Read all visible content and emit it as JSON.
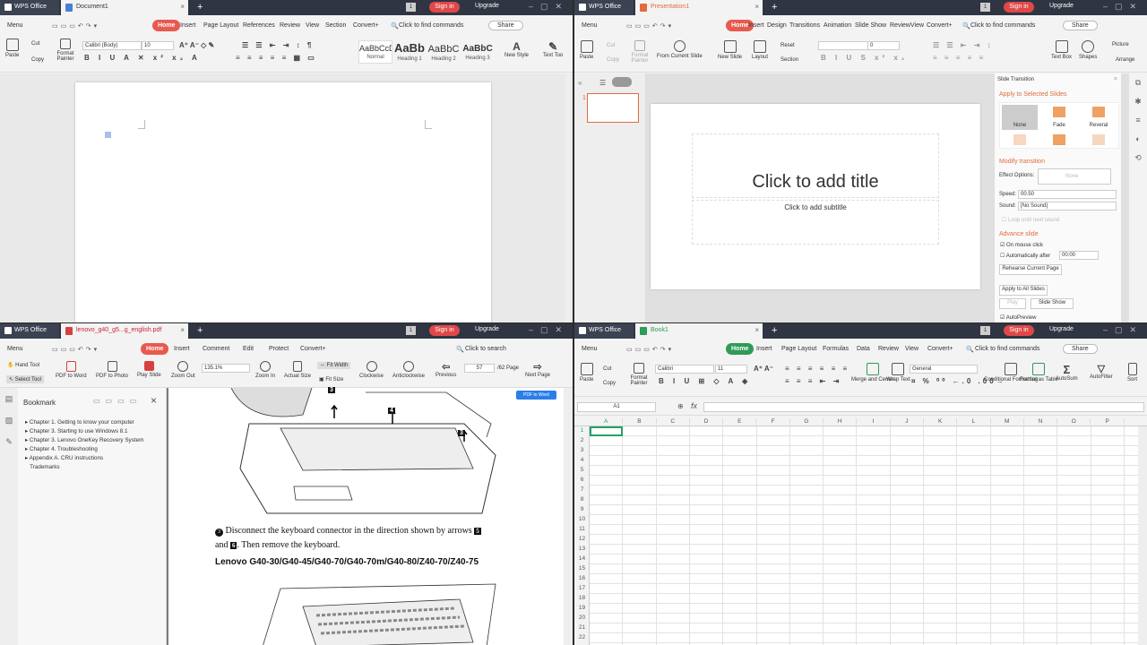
{
  "writer": {
    "app_tab": "WPS Office",
    "doc_tab": "Document1",
    "menu": [
      "Menu",
      "Home",
      "Insert",
      "Page Layout",
      "References",
      "Review",
      "View",
      "Section",
      "Convert+"
    ],
    "find": "Click to find commands",
    "share": "Share",
    "sign_in": "Sign in",
    "upgrade": "Upgrade",
    "paste": "Paste",
    "cut": "Cut",
    "copy": "Copy",
    "format_painter": "Format Painter",
    "font": "Calibri (Body)",
    "size": "10",
    "styles": [
      {
        "sample": "AaBbCcDd",
        "label": "Normal"
      },
      {
        "sample": "AaBb",
        "label": "Heading 1"
      },
      {
        "sample": "AaBbC",
        "label": "Heading 2"
      },
      {
        "sample": "AaBbC",
        "label": "Heading 3"
      }
    ],
    "new_style": "New Style",
    "text_tool": "Text Too"
  },
  "presentation": {
    "app_tab": "WPS Office",
    "doc_tab": "Presentation1",
    "menu": [
      "Menu",
      "Home",
      "Insert",
      "Design",
      "Transitions",
      "Animation",
      "Slide Show",
      "Review",
      "View",
      "Convert+"
    ],
    "find": "Click to find commands",
    "share": "Share",
    "sign_in": "Sign in",
    "upgrade": "Upgrade",
    "paste": "Paste",
    "cut": "Cut",
    "copy": "Copy",
    "format_painter": "Format Painter",
    "from_current": "From Current Slide",
    "new_slide": "New Slide",
    "layout": "Layout",
    "reset": "Reset",
    "section": "Section",
    "font_size": "0",
    "text_box": "Text Box",
    "shapes": "Shapes",
    "picture": "Picture",
    "arrange": "Arrange",
    "slide_num": "1",
    "title_placeholder": "Click to add title",
    "subtitle_placeholder": "Click to add subtitle",
    "pane": {
      "title": "Slide Transition",
      "apply_selected": "Apply to Selected Slides",
      "transitions": [
        "None",
        "Fade",
        "Reveral"
      ],
      "modify": "Modify transition",
      "effect_label": "Effect Options:",
      "effect_value": "None",
      "speed_label": "Speed:",
      "speed_value": "00.50",
      "sound_label": "Sound:",
      "sound_value": "[No Sound]",
      "loop": "Loop until next sound",
      "advance": "Advance slide",
      "on_click": "On mouse click",
      "auto_after": "Automatically after",
      "auto_time": "00:00",
      "rehearse": "Rehearse Current Page",
      "apply_all": "Apply to All Slides",
      "play": "Play",
      "slide_show": "Slide Show",
      "autopreview": "AutoPreview"
    }
  },
  "pdf": {
    "app_tab": "WPS Office",
    "doc_tab": "lenovo_g40_g5...g_english.pdf",
    "menu": [
      "Menu",
      "Home",
      "Insert",
      "Comment",
      "Edit",
      "Protect",
      "Convert+"
    ],
    "search": "Click to search",
    "sign_in": "Sign in",
    "upgrade": "Upgrade",
    "hand_tool": "Hand Tool",
    "select_tool": "Select Tool",
    "pdf_to_word": "PDF to Word",
    "pdf_to_photo": "PDF to Photo",
    "play_slide": "Play Slide",
    "zoom_out": "Zoom Out",
    "zoom_value": "135.1%",
    "zoom_in": "Zoom In",
    "actual_size": "Actual Size",
    "fit_width": "Fit Width",
    "fit_size": "Fit Size",
    "clockwise": "Clockwise",
    "anticlockwise": "Anticlockwise",
    "previous": "Previous",
    "page_value": "57",
    "page_total": "/62 Page",
    "next_page": "Next Page",
    "pdf_to_word_badge": "PDF to Word",
    "bookmark_title": "Bookmark",
    "bookmarks": [
      "Chapter 1. Getting to know your computer",
      "Chapter 3. Starting to use Windows 8.1",
      "Chapter 3. Lenovo OneKey Recovery System",
      "Chapter 4. Troubleshooting",
      "Appendix A. CRU instructions",
      "Trademarks"
    ],
    "step_text_1": "Disconnect the keyboard connector in the direction shown by arrows",
    "step_text_2": ". Then remove the keyboard.",
    "step_word_and": "and",
    "model_heading": "Lenovo G40-30/G40-45/G40-70/G40-70m/G40-80/Z40-70/Z40-75",
    "callouts": [
      "3",
      "4",
      "3",
      "5",
      "6"
    ]
  },
  "sheet": {
    "app_tab": "WPS Office",
    "doc_tab": "Book1",
    "menu": [
      "Menu",
      "Home",
      "Insert",
      "Page Layout",
      "Formulas",
      "Data",
      "Review",
      "View",
      "Convert+"
    ],
    "find": "Click to find commands",
    "share": "Share",
    "sign_in": "Sign in",
    "upgrade": "Upgrade",
    "paste": "Paste",
    "cut": "Cut",
    "copy": "Copy",
    "format_painter": "Format Painter",
    "font": "Calibri",
    "size": "11",
    "merge_center": "Merge and Center",
    "wrap_text": "Wrap Text",
    "number_format": "General",
    "conditional_formatting": "Conditional Formatting",
    "format_table": "Format as Table",
    "autosum": "AutoSum",
    "autofilter": "AutoFilter",
    "sort": "Sort",
    "name_box": "A1",
    "columns": [
      "A",
      "B",
      "C",
      "D",
      "E",
      "F",
      "G",
      "H",
      "I",
      "J",
      "K",
      "L",
      "M",
      "N",
      "O",
      "P"
    ],
    "rows": [
      "1",
      "2",
      "3",
      "4",
      "5",
      "6",
      "7",
      "8",
      "9",
      "10",
      "11",
      "12",
      "13",
      "14",
      "15",
      "16",
      "17",
      "18",
      "19",
      "20",
      "21",
      "22"
    ]
  },
  "colors": {
    "titlebar": "#2f3542",
    "accent": "#e85a4f",
    "writer_icon": "#4a7fd6",
    "ppt_icon": "#e06b3c",
    "pdf_icon": "#d84040",
    "sheet_icon": "#2e9b57",
    "selection_green": "#21a366"
  }
}
